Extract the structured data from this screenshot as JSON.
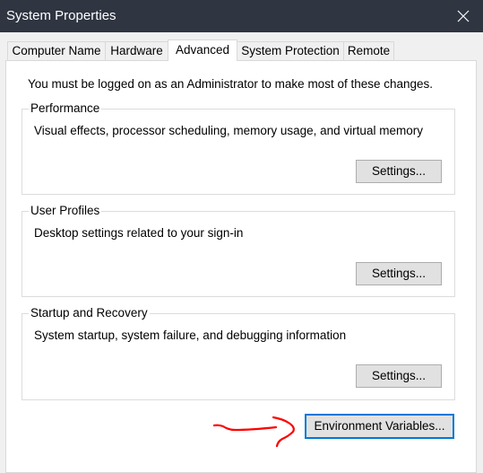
{
  "window": {
    "title": "System Properties",
    "close_icon": "close-icon"
  },
  "tabs": [
    {
      "label": "Computer Name",
      "active": false
    },
    {
      "label": "Hardware",
      "active": false
    },
    {
      "label": "Advanced",
      "active": true
    },
    {
      "label": "System Protection",
      "active": false
    },
    {
      "label": "Remote",
      "active": false
    }
  ],
  "advanced": {
    "admin_notice": "You must be logged on as an Administrator to make most of these changes.",
    "groups": [
      {
        "title": "Performance",
        "description": "Visual effects, processor scheduling, memory usage, and virtual memory",
        "button_label": "Settings..."
      },
      {
        "title": "User Profiles",
        "description": "Desktop settings related to your sign-in",
        "button_label": "Settings..."
      },
      {
        "title": "Startup and Recovery",
        "description": "System startup, system failure, and debugging information",
        "button_label": "Settings..."
      }
    ],
    "env_button_label": "Environment Variables..."
  },
  "annotation": {
    "type": "hand-drawn-arrow",
    "color": "#ff0000",
    "points_to": "Environment Variables..."
  },
  "colors": {
    "titlebar_bg": "#2f3541",
    "focus_border": "#0078d7",
    "button_bg": "#e1e1e1"
  }
}
